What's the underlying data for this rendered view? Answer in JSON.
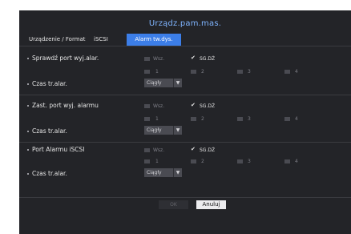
{
  "window": {
    "title": "Urządz.pam.mas."
  },
  "tabs": [
    {
      "label": "Urządzenie / Format",
      "active": false
    },
    {
      "label": "iSCSI",
      "active": false
    },
    {
      "label": "Alarm tw.dys.",
      "active": true
    }
  ],
  "common": {
    "wsz_label": "Wsz.",
    "sgdz_label": "SG.DŻ",
    "ports": [
      "1",
      "2",
      "3",
      "4"
    ],
    "duration_label": "Czas tr.alar.",
    "duration_value": "Ciągły",
    "caret": "▼",
    "check": "✔"
  },
  "sections": [
    {
      "label": "Sprawdź port wyj.alar.",
      "wsz_checked": false,
      "sgdz_checked": true,
      "ports_checked": [
        false,
        false,
        false,
        false
      ]
    },
    {
      "label": "Zast. port wyj. alarmu",
      "wsz_checked": false,
      "sgdz_checked": true,
      "ports_checked": [
        false,
        false,
        false,
        false
      ]
    },
    {
      "label": "Port Alarmu iSCSI",
      "wsz_checked": false,
      "sgdz_checked": true,
      "ports_checked": [
        false,
        false,
        false,
        false
      ]
    }
  ],
  "buttons": {
    "ok": "OK",
    "cancel": "Anuluj"
  },
  "colors": {
    "active_tab": "#3c7ee8",
    "title": "#7fb4ff",
    "background": "#232428"
  }
}
